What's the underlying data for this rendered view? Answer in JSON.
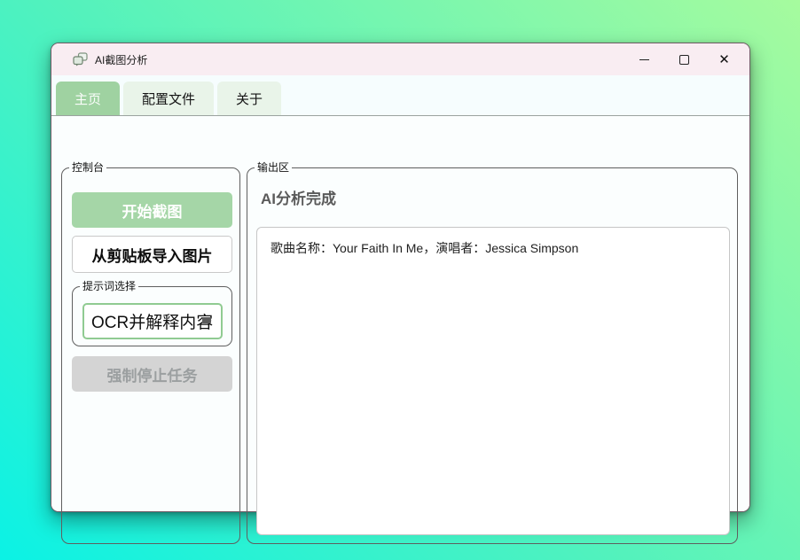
{
  "window": {
    "title": "AI截图分析"
  },
  "tabs": [
    {
      "label": "主页",
      "active": true
    },
    {
      "label": "配置文件",
      "active": false
    },
    {
      "label": "关于",
      "active": false
    }
  ],
  "console_panel": {
    "group_label": "控制台",
    "start_button_label": "开始截图",
    "clipboard_button_label": "从剪贴板导入图片",
    "prompt_group_label": "提示词选择",
    "prompt_selected_option": "OCR并解释内容",
    "stop_button_label": "强制停止任务",
    "stop_button_state": "disabled"
  },
  "output_panel": {
    "group_label": "输出区",
    "status_heading": "AI分析完成",
    "result_text": "歌曲名称：Your Faith In Me，演唱者：Jessica Simpson"
  },
  "colors": {
    "accent_green": "#a5d6a7",
    "active_tab_bg": "#9fd2a1",
    "inactive_tab_bg": "#e9f4e9",
    "titlebar_bg": "#f9edf2",
    "tabstrip_bg": "#f6fdfe",
    "dropdown_border": "#90cb92",
    "disabled_button_bg": "#d4d4d4",
    "disabled_button_text": "#9b9fa0",
    "desktop_gradient": [
      "#a6fb9e",
      "#52f2bd",
      "#0bf2e5"
    ]
  }
}
